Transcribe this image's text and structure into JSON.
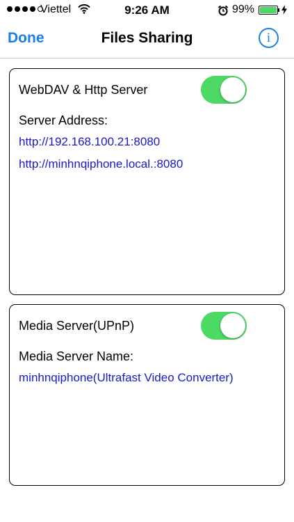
{
  "status_bar": {
    "carrier": "Viettel",
    "time": "9:26 AM",
    "battery": "99%",
    "signal_bars_filled": 4,
    "signal_bars_total": 5,
    "battery_level": 0.99,
    "icons": [
      "wifi-icon",
      "alarm-icon",
      "battery-icon",
      "charging-bolt-icon"
    ]
  },
  "nav": {
    "done_label": "Done",
    "title": "Files Sharing",
    "info_label": "i"
  },
  "webdav": {
    "title": "WebDAV & Http Server",
    "toggle_on": true,
    "address_label": "Server Address:",
    "address_ip": "http://192.168.100.21:8080",
    "address_host": "http://minhnqiphone.local.:8080"
  },
  "media": {
    "title": "Media Server(UPnP)",
    "toggle_on": true,
    "name_label": "Media Server Name:",
    "name_value": "minhnqiphone(Ultrafast Video Converter)"
  },
  "colors": {
    "accent": "#1a7ee8",
    "link": "#1919c8",
    "toggle_on": "#4cd964"
  }
}
